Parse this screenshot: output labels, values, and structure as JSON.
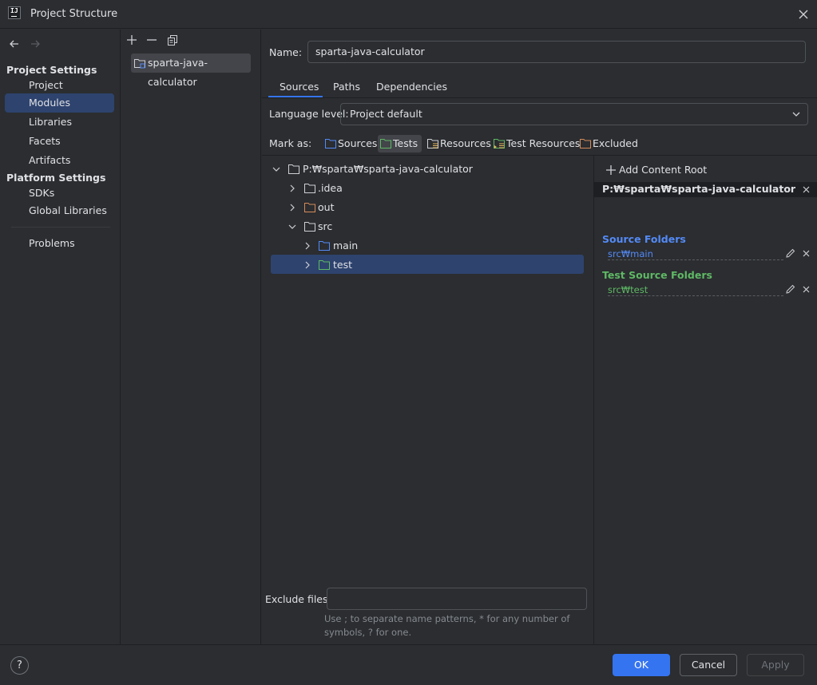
{
  "window": {
    "title": "Project Structure"
  },
  "nav": {
    "sections": [
      {
        "label": "Project Settings"
      },
      {
        "label": "Platform Settings"
      }
    ],
    "items": [
      {
        "label": "Project"
      },
      {
        "label": "Modules"
      },
      {
        "label": "Libraries"
      },
      {
        "label": "Facets"
      },
      {
        "label": "Artifacts"
      },
      {
        "label": "SDKs"
      },
      {
        "label": "Global Libraries"
      },
      {
        "label": "Problems"
      }
    ],
    "selected": "Modules"
  },
  "modules": {
    "items": [
      {
        "label": "sparta-java-calculator"
      }
    ]
  },
  "main": {
    "name_label": "Name:",
    "name_value": "sparta-java-calculator",
    "tabs": [
      {
        "label": "Sources"
      },
      {
        "label": "Paths"
      },
      {
        "label": "Dependencies"
      }
    ],
    "active_tab": "Sources",
    "language_level_label": "Language level:",
    "language_level_value": "Project default",
    "mark_as_label": "Mark as:",
    "mark_as": [
      {
        "label": "Sources",
        "color": "#548af7"
      },
      {
        "label": "Tests",
        "color": "#5fb865"
      },
      {
        "label": "Resources",
        "color": "#ced0d6"
      },
      {
        "label": "Test Resources",
        "color": "#5fb865"
      },
      {
        "label": "Excluded",
        "color": "#d38a5a"
      }
    ],
    "tree": [
      {
        "label": "P:₩sparta₩sparta-java-calculator"
      },
      {
        "label": ".idea"
      },
      {
        "label": "out"
      },
      {
        "label": "src"
      },
      {
        "label": "main"
      },
      {
        "label": "test"
      }
    ],
    "exclude_label": "Exclude files:",
    "exclude_value": "",
    "exclude_hint": "Use ; to separate name patterns, * for any number of symbols, ? for one."
  },
  "roots": {
    "add_label": "Add Content Root",
    "root_path": "P:₩sparta₩sparta-java-calculator",
    "source_title": "Source Folders",
    "source_path": "src₩main",
    "test_title": "Test Source Folders",
    "test_path": "src₩test",
    "source_color": "#548af7",
    "test_color": "#5fb865"
  },
  "buttons": {
    "help": "?",
    "ok": "OK",
    "cancel": "Cancel",
    "apply": "Apply"
  }
}
